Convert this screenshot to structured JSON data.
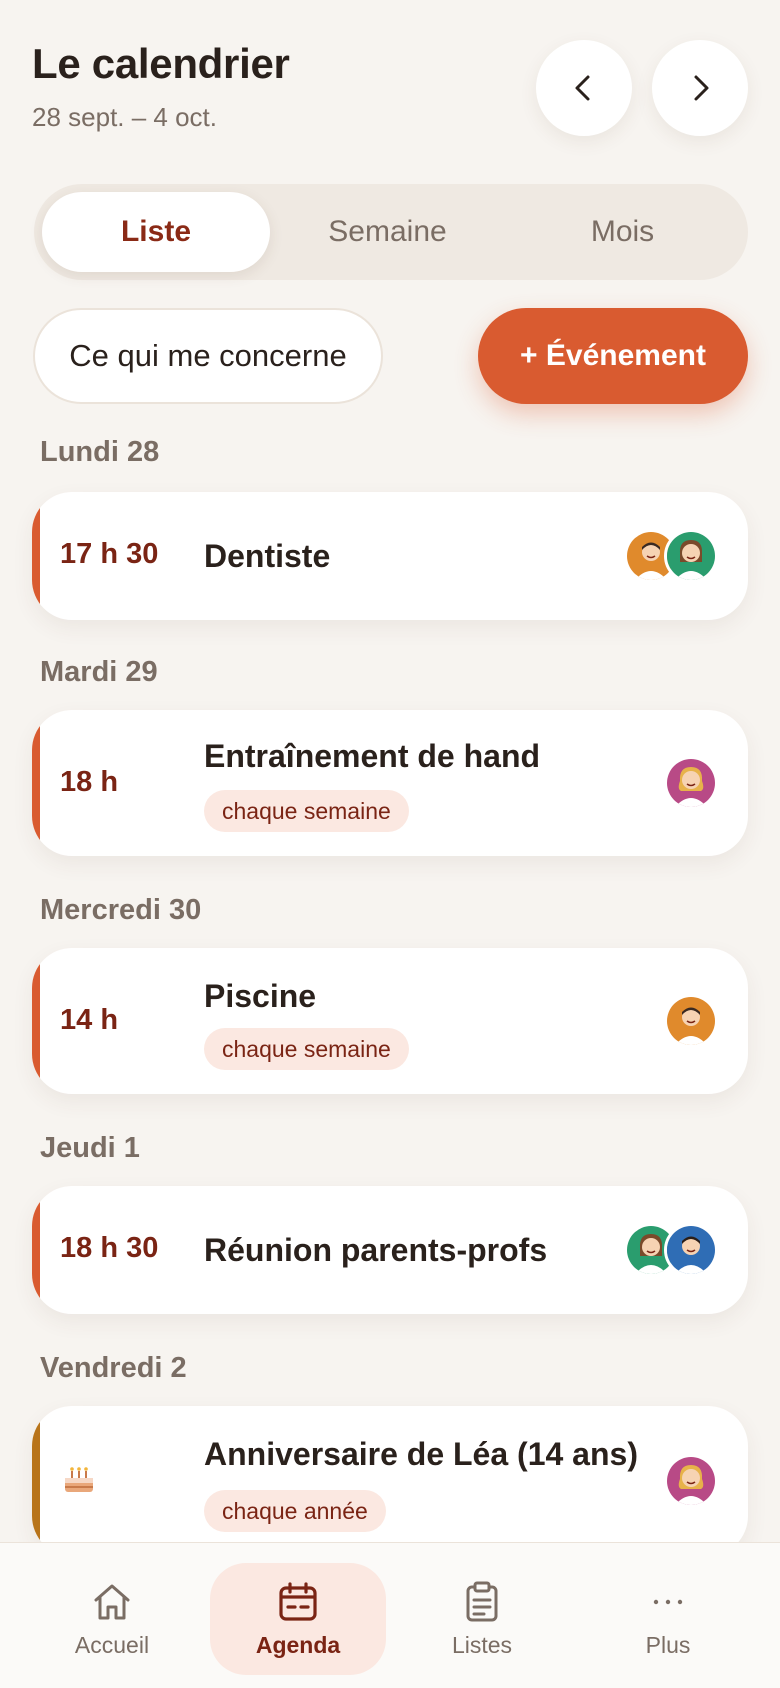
{
  "header": {
    "title": "Le calendrier",
    "range": "28 sept. – 4 oct.",
    "prev_icon": "chevron-left-icon",
    "next_icon": "chevron-right-icon"
  },
  "view_tabs": [
    {
      "label": "Liste",
      "active": true
    },
    {
      "label": "Semaine",
      "active": false
    },
    {
      "label": "Mois",
      "active": false
    }
  ],
  "filter_label": "Ce qui me concerne",
  "add_event_label": "+ Événement",
  "days": [
    {
      "heading": "Lundi 28",
      "events": [
        {
          "time": "17 h 30",
          "title": "Dentiste",
          "tag": "",
          "avatars": [
            "orange",
            "green"
          ]
        }
      ]
    },
    {
      "heading": "Mardi 29",
      "events": [
        {
          "time": "18 h",
          "title": "Entraînement de hand",
          "tag": "chaque semaine",
          "avatars": [
            "pink"
          ]
        }
      ]
    },
    {
      "heading": "Mercredi 30",
      "events": [
        {
          "time": "14 h",
          "title": "Piscine",
          "tag": "chaque semaine",
          "avatars": [
            "orange"
          ]
        }
      ]
    },
    {
      "heading": "Jeudi 1",
      "events": [
        {
          "time": "18 h 30",
          "title": "Réunion parents-profs",
          "tag": "",
          "avatars": [
            "green",
            "blue"
          ]
        }
      ]
    },
    {
      "heading": "Vendredi 2",
      "events": [
        {
          "time": "",
          "icon": "cake-icon",
          "title": "Anniversaire de Léa (14 ans)",
          "tag": "chaque année",
          "avatars": [
            "pink"
          ]
        }
      ]
    }
  ],
  "bottom_nav": [
    {
      "label": "Accueil",
      "icon": "home-icon",
      "active": false
    },
    {
      "label": "Agenda",
      "icon": "calendar-icon",
      "active": true
    },
    {
      "label": "Listes",
      "icon": "clipboard-icon",
      "active": false
    },
    {
      "label": "Plus",
      "icon": "more-icon",
      "active": false
    }
  ],
  "colors": {
    "accent": "#d95b30",
    "accent_dark": "#7a2414",
    "birthday_accent": "#b8741a",
    "background": "#f7f4f0",
    "avatar_orange": "#e08a2c",
    "avatar_green": "#2a9d6e",
    "avatar_pink": "#b84a86",
    "avatar_blue": "#2f6db5"
  }
}
